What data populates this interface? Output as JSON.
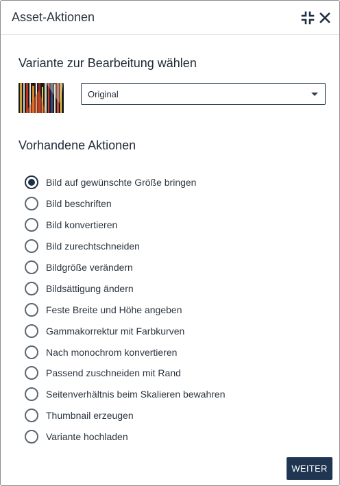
{
  "header": {
    "title": "Asset-Aktionen",
    "collapse_icon": "collapse-icon",
    "close_icon": "close-icon"
  },
  "variant": {
    "title": "Variante zur Bearbeitung wählen",
    "selected": "Original"
  },
  "actions": {
    "title": "Vorhandene Aktionen",
    "selected_index": 0,
    "items": [
      "Bild auf gewünschte Größe bringen",
      "Bild beschriften",
      "Bild konvertieren",
      "Bild zurechtschneiden",
      "Bildgröße verändern",
      "Bildsättigung ändern",
      "Feste Breite und Höhe angeben",
      "Gammakorrektur mit Farbkurven",
      "Nach monochrom konvertieren",
      "Passend zuschneiden mit Rand",
      "Seitenverhältnis beim Skalieren bewahren",
      "Thumbnail erzeugen",
      "Variante hochladen"
    ]
  },
  "footer": {
    "next_label": "WEITER"
  },
  "colors": {
    "primary": "#1f3552",
    "radio_selected": "#1f2f45",
    "text": "#2b3440"
  }
}
